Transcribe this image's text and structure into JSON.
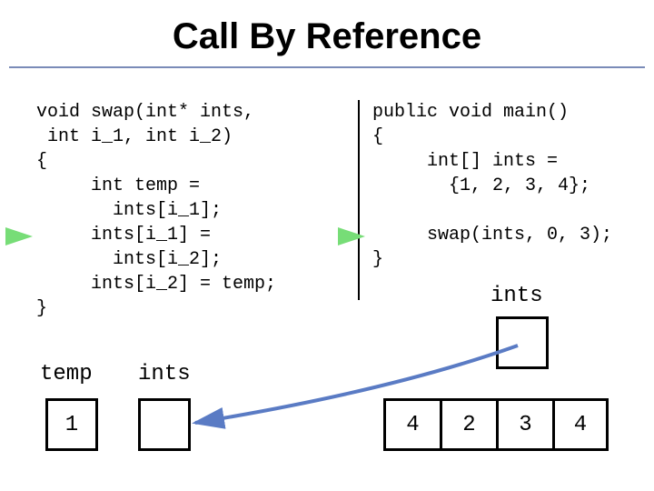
{
  "title": "Call By Reference",
  "left_code": "void swap(int* ints,\n int i_1, int i_2)\n{\n     int temp =\n       ints[i_1];\n     ints[i_1] =\n       ints[i_2];\n     ints[i_2] = temp;\n}",
  "right_code": "public void main()\n{\n     int[] ints =\n       {1, 2, 3, 4};\n\n     swap(ints, 0, 3);\n}",
  "labels": {
    "temp": "temp",
    "ints_left": "ints",
    "ints_right": "ints"
  },
  "temp_value": "1",
  "ints_left_value": "",
  "ints_right_box": "",
  "array": [
    "4",
    "2",
    "3",
    "4"
  ]
}
